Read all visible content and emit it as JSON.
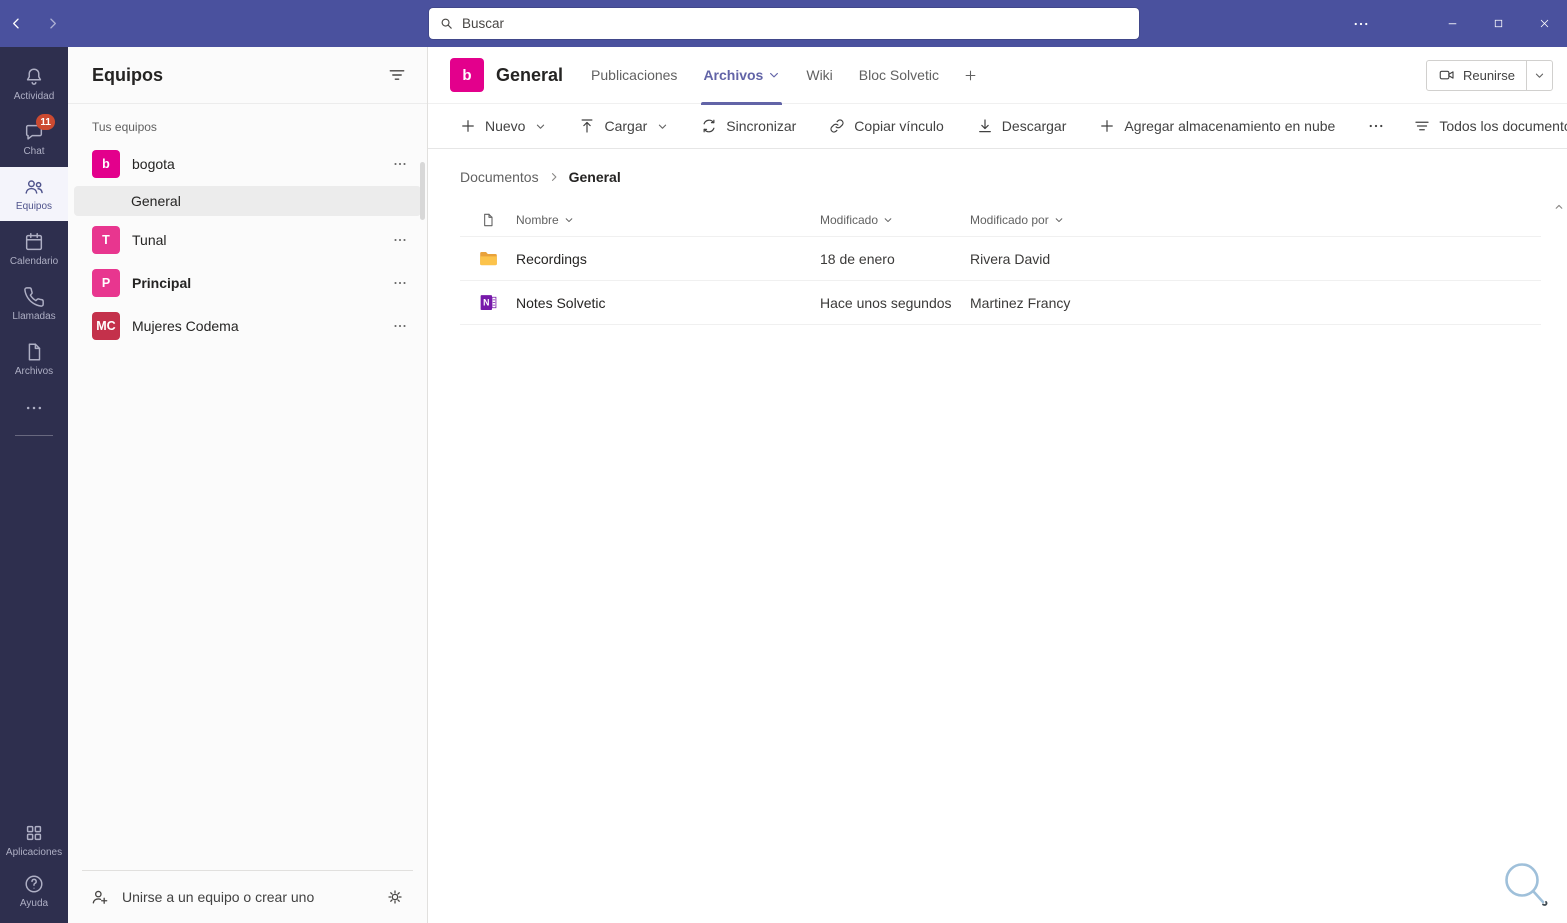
{
  "colors": {
    "titlebar": "#4a519e",
    "rail": "#2e2f4e",
    "accent": "#6264A7",
    "badge": "#CC4A31",
    "onenote": "#7719AA",
    "folder_back": "#E9A23B",
    "folder_front": "#FCC34B"
  },
  "titlebar": {
    "search_placeholder": "Buscar"
  },
  "rail": {
    "items": [
      {
        "label": "Actividad",
        "icon": "bell-icon",
        "badge": "",
        "active": false
      },
      {
        "label": "Chat",
        "icon": "chat-icon",
        "badge": "11",
        "active": false
      },
      {
        "label": "Equipos",
        "icon": "teams-icon",
        "badge": "",
        "active": true
      },
      {
        "label": "Calendario",
        "icon": "calendar-icon",
        "badge": "",
        "active": false
      },
      {
        "label": "Llamadas",
        "icon": "phone-icon",
        "badge": "",
        "active": false
      },
      {
        "label": "Archivos",
        "icon": "files-icon",
        "badge": "",
        "active": false
      }
    ],
    "bottom_items": [
      {
        "label": "Aplicaciones",
        "icon": "apps-icon"
      },
      {
        "label": "Ayuda",
        "icon": "help-icon"
      }
    ]
  },
  "sidebar": {
    "title": "Equipos",
    "section_label": "Tus equipos",
    "teams": [
      {
        "initial": "b",
        "name": "bogota",
        "color": "#E3008C",
        "unread": false
      },
      {
        "initial": "T",
        "name": "Tunal",
        "color": "#E8368F",
        "unread": false
      },
      {
        "initial": "P",
        "name": "Principal",
        "color": "#E8368F",
        "unread": true
      },
      {
        "initial": "MC",
        "name": "Mujeres Codema",
        "color": "#C4314B",
        "unread": false
      }
    ],
    "selected_channel": "General",
    "join_label": "Unirse a un equipo o crear uno"
  },
  "channel": {
    "team_initial": "b",
    "avatar_color": "#E3008C",
    "title": "General",
    "tabs": [
      "Publicaciones",
      "Archivos",
      "Wiki",
      "Bloc Solvetic"
    ],
    "active_tab": "Archivos",
    "meet_label": "Reunirse"
  },
  "toolbar": {
    "new_label": "Nuevo",
    "upload_label": "Cargar",
    "sync_label": "Sincronizar",
    "copy_link_label": "Copiar vínculo",
    "download_label": "Descargar",
    "add_cloud_label": "Agregar almacenamiento en nube",
    "view_label": "Todos los documentos"
  },
  "breadcrumb": {
    "root": "Documentos",
    "current": "General"
  },
  "files": {
    "columns": {
      "name": "Nombre",
      "modified": "Modificado",
      "modified_by": "Modificado por"
    },
    "rows": [
      {
        "icon": "folder-icon",
        "name": "Recordings",
        "modified": "18 de enero",
        "modified_by": "Rivera David"
      },
      {
        "icon": "onenote-icon",
        "name": "Notes Solvetic",
        "modified": "Hace unos segundos",
        "modified_by": "Martinez Francy"
      }
    ]
  }
}
